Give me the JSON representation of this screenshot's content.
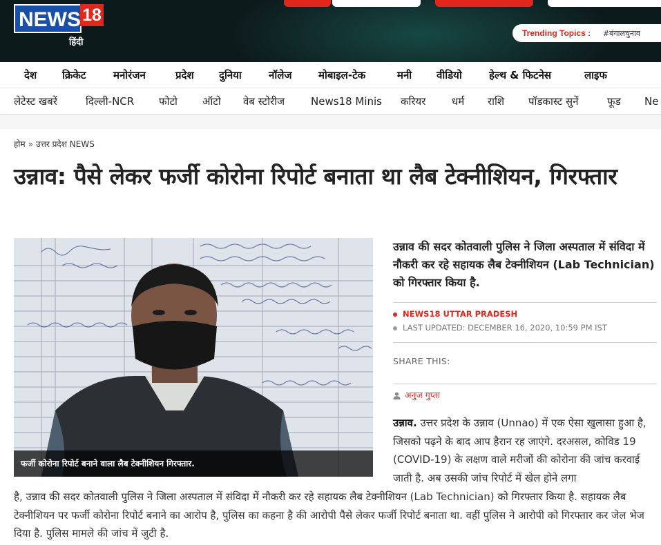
{
  "header": {
    "logo": {
      "brand": "NEWS",
      "number": "18",
      "language": "हिंदी"
    },
    "trending": {
      "label": "Trending Topics :",
      "tag": "#बंगालचुनाव"
    }
  },
  "nav_primary": [
    "देश",
    "क्रिकेट",
    "मनोरंजन",
    "प्रदेश",
    "दुनिया",
    "नॉलेज",
    "मोबाइल-टेक",
    "मनी",
    "वीडियो",
    "हेल्थ & फिटनेस",
    "लाइफ"
  ],
  "nav_secondary": [
    "लेटेस्ट खबरें",
    "दिल्ली-NCR",
    "फोटो",
    "ऑटो",
    "वेब स्टोरीज",
    "News18 Minis",
    "करियर",
    "धर्म",
    "राशि",
    "पॉडकास्ट सुनें",
    "फूड",
    "Ne"
  ],
  "breadcrumb": {
    "home": "होम",
    "separator": "»",
    "section": "उत्तर प्रदेश NEWS"
  },
  "article": {
    "headline": "उन्नाव: पैसे लेकर फर्जी कोरोना रिपोर्ट बनाता था लैब टेक्नीशियन, गिरफ्तार",
    "image_caption": "फर्जी कोरोना रिपोर्ट बनाने वाला लैब टेक्नीशियन गिरफ्तार.",
    "summary": "उन्नाव की सदर कोतवाली पुलिस ने जिला अस्पताल में संविदा में नौकरी कर रहे सहायक लैब टेक्नीशियन (Lab Technician) को गिरफ्तार किया है.",
    "source": "NEWS18 UTTAR PRADESH",
    "last_updated": "LAST UPDATED: DECEMBER 16, 2020, 10:59 PM IST",
    "share_label": "SHARE THIS:",
    "author": "अनुज गुप्ता",
    "dateline": "उन्नाव.",
    "body_top": "उत्तर प्रदेश के उन्नाव (Unnao) में एक ऐसा खुलासा हुआ है, जिसको पढ़ने के बाद आप हैरान रह जाएंगे. दरअसल, कोविड 19 (COVID-19) के लक्षण वाले मरीजों की कोरोना की जांच करवाई जाती है. अब उसकी जांच रिपोर्ट में खेल होने लगा",
    "body_rest": "है, उन्नाव की सदर कोतवाली पुलिस ने जिला अस्पताल में संविदा में नौकरी कर रहे सहायक लैब टेक्नीशियन (Lab Technician) को गिरफ्तार किया है. सहायक लैब टेक्नीशियन पर फर्जी कोरोना रिपोर्ट बनाने का आरोप है, पुलिस का कहना है की आरोपी पैसे लेकर फर्जी रिपोर्ट बनाता था. वहीं पुलिस ने आरोपी को गिरफ्तार कर जेल भेज दिया है. पुलिस मामले की जांच में जुटी है."
  },
  "colors": {
    "brand_red": "#e1261c",
    "brand_blue": "#1a4fa8",
    "header_bg": "#0d1a1c"
  }
}
